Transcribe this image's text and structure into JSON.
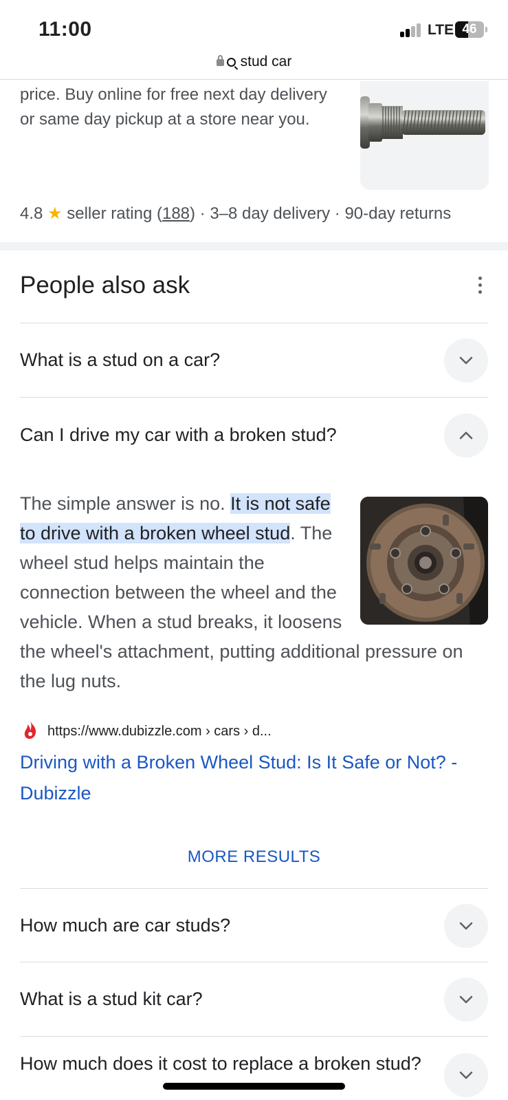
{
  "status_bar": {
    "time": "11:00",
    "network": "LTE",
    "battery": "46",
    "battery_level": 0.46
  },
  "url_bar": {
    "query": "stud car"
  },
  "shopping_result": {
    "description": "price. Buy online for free next day delivery or same day pickup at a store near you.",
    "rating": "4.8",
    "rating_label": "seller rating",
    "rating_count": "188",
    "delivery": "3–8 day delivery",
    "returns": "90-day returns"
  },
  "paa": {
    "title": "People also ask",
    "questions": [
      {
        "text": "What is a stud on a car?",
        "expanded": false
      },
      {
        "text": "Can I drive my car with a broken stud?",
        "expanded": true
      },
      {
        "text": "How much are car studs?",
        "expanded": false
      },
      {
        "text": "What is a stud kit car?",
        "expanded": false
      },
      {
        "text": "How much does it cost to replace a broken stud?",
        "expanded": false
      }
    ],
    "answer": {
      "intro": "The simple answer is no. ",
      "highlight": "It is not safe to drive with a broken wheel stud",
      "rest": ". The wheel stud helps maintain the connection between the wheel and the vehicle. When a stud breaks, it loosens the wheel's attachment, putting additional pressure on the lug nuts.",
      "source_url": "https://www.dubizzle.com › cars › d...",
      "link_title": "Driving with a Broken Wheel Stud: Is It Safe or Not? - Dubizzle"
    },
    "more_results": "MORE RESULTS"
  },
  "colors": {
    "link": "#1a57c4",
    "highlight": "#d2e3fc",
    "star": "#f6b500"
  }
}
